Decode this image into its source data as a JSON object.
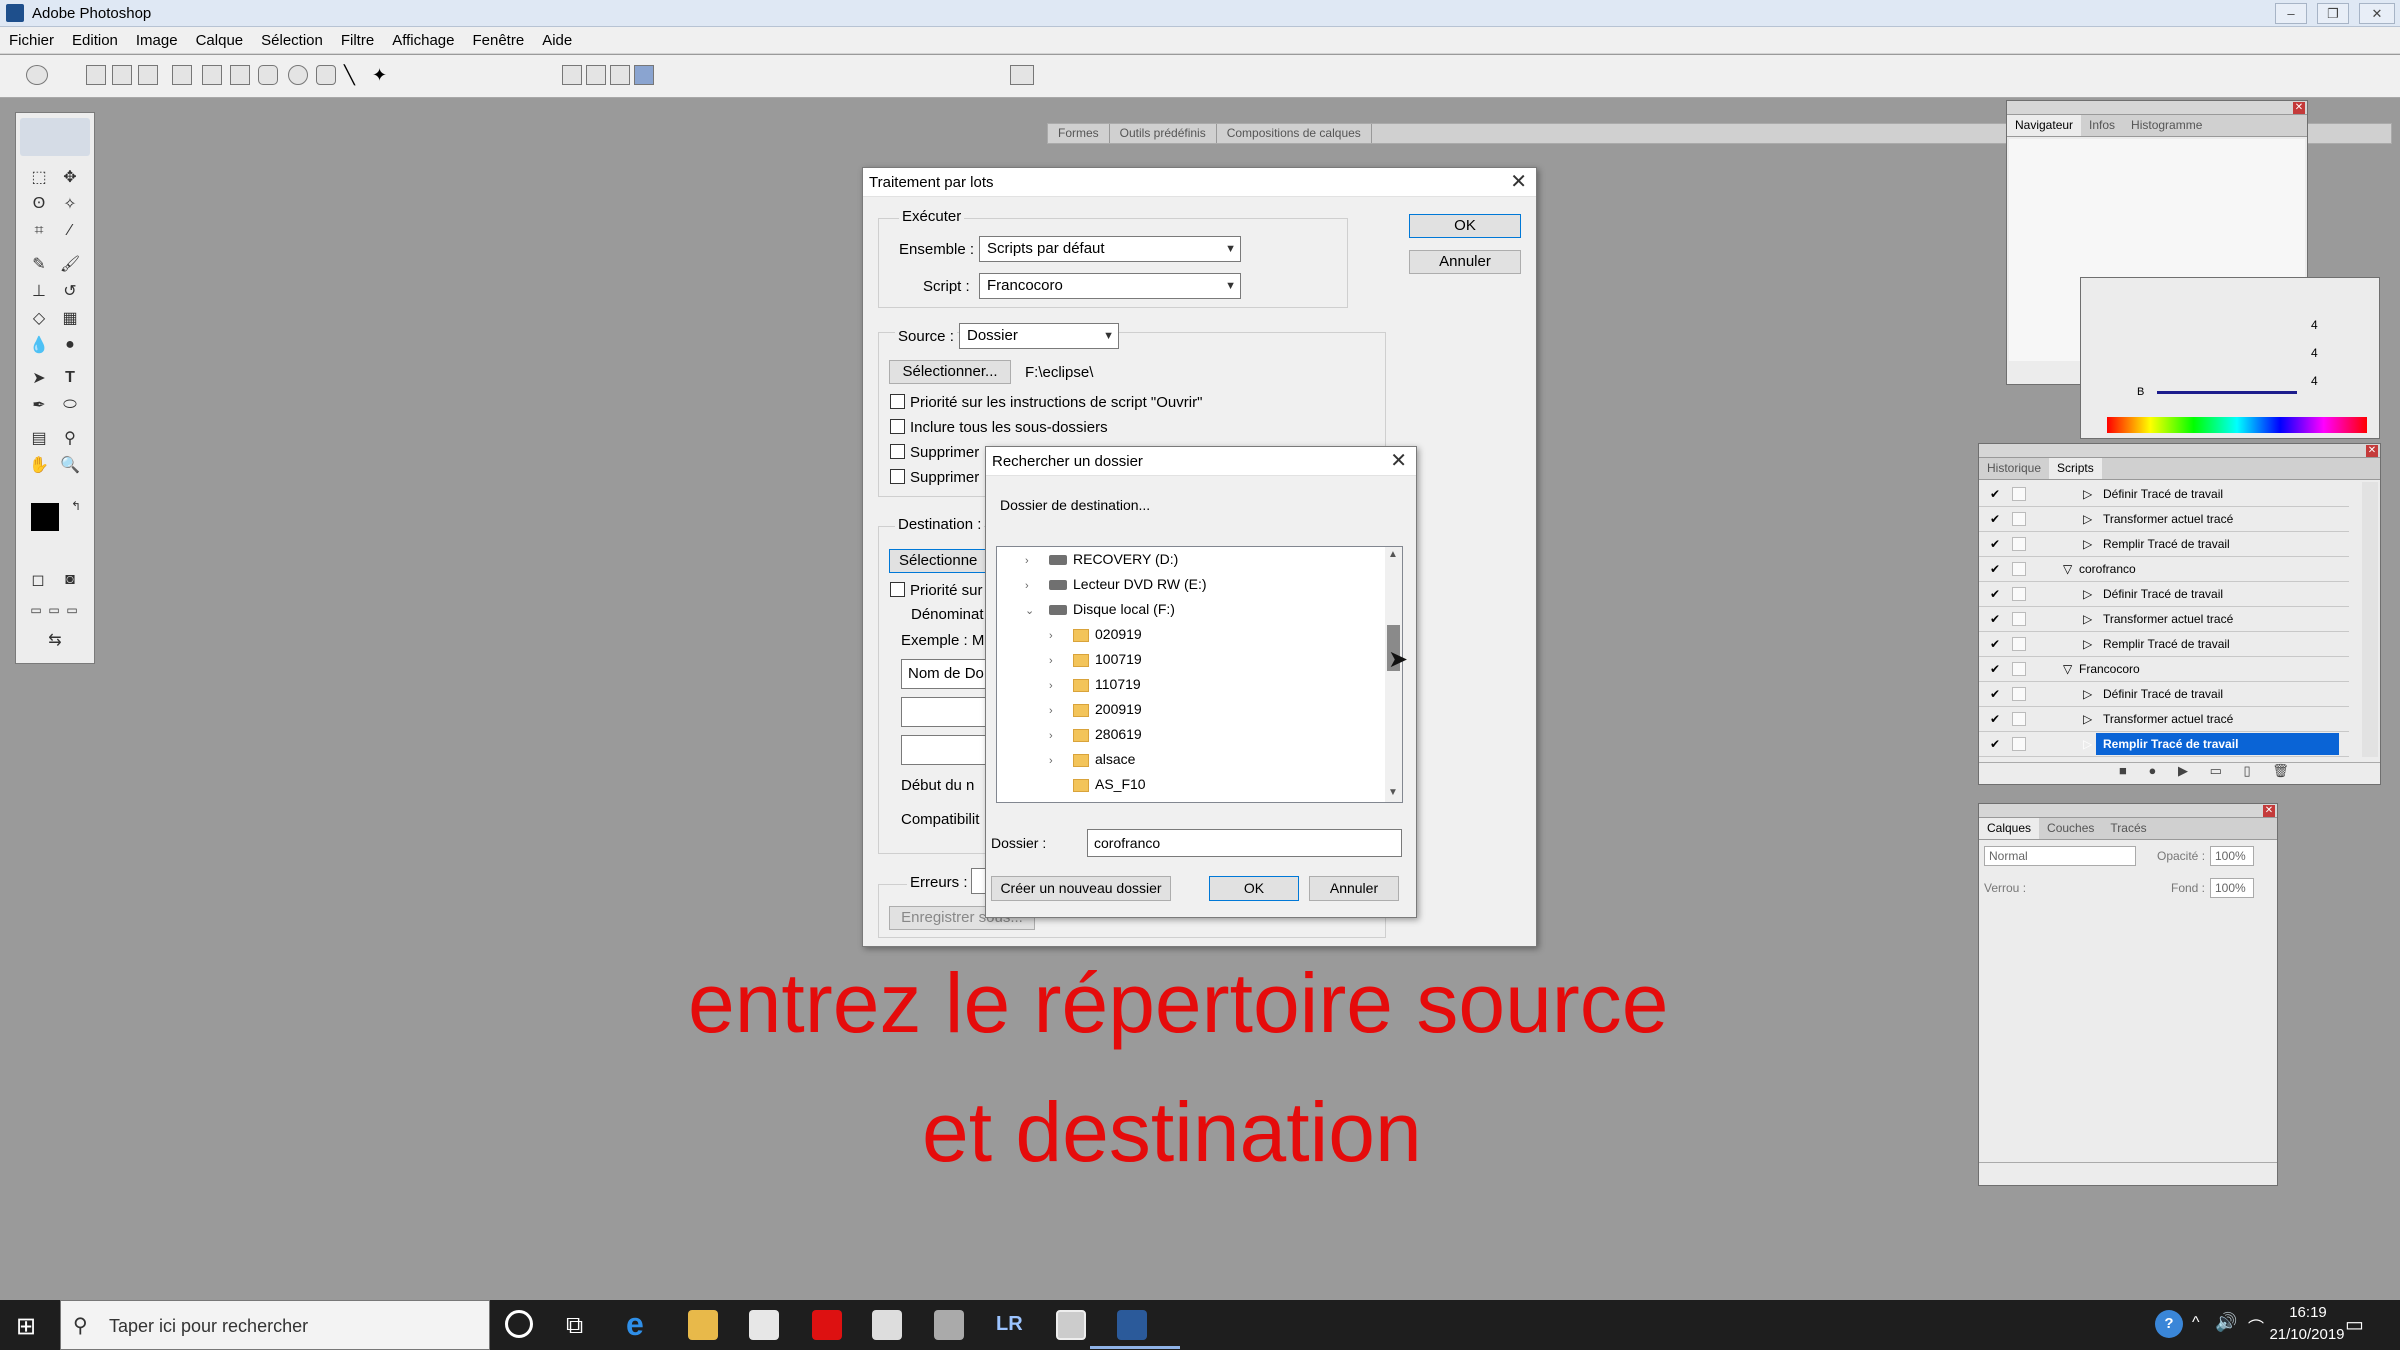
{
  "app": {
    "title": "Adobe Photoshop"
  },
  "menu": [
    "Fichier",
    "Edition",
    "Image",
    "Calque",
    "Sélection",
    "Filtre",
    "Affichage",
    "Fenêtre",
    "Aide"
  ],
  "palette_well": {
    "tabs": [
      "Formes",
      "Outils prédéfinis",
      "Compositions de calques"
    ]
  },
  "navigator": {
    "tabs": [
      "Navigateur",
      "Infos",
      "Histogramme"
    ]
  },
  "color_panel": {
    "values": [
      "4",
      "4",
      "4"
    ],
    "b_label": "B"
  },
  "scripts_panel": {
    "tabs": [
      "Historique",
      "Scripts"
    ],
    "rows": [
      {
        "label": "Définir Tracé de travail",
        "level": 2
      },
      {
        "label": "Transformer actuel tracé",
        "level": 2
      },
      {
        "label": "Remplir Tracé de travail",
        "level": 2
      },
      {
        "label": "corofranco",
        "level": 1
      },
      {
        "label": "Définir Tracé de travail",
        "level": 2
      },
      {
        "label": "Transformer actuel tracé",
        "level": 2
      },
      {
        "label": "Remplir Tracé de travail",
        "level": 2
      },
      {
        "label": "Francocoro",
        "level": 1
      },
      {
        "label": "Définir Tracé de travail",
        "level": 2
      },
      {
        "label": "Transformer actuel tracé",
        "level": 2
      },
      {
        "label": "Remplir Tracé de travail",
        "level": 2,
        "selected": true
      }
    ]
  },
  "layers_panel": {
    "tabs": [
      "Calques",
      "Couches",
      "Tracés"
    ],
    "mode": "Normal",
    "opacity_label": "Opacité :",
    "opacity": "100%",
    "lock_label": "Verrou :",
    "fill_label": "Fond :",
    "fill": "100%"
  },
  "batch_dialog": {
    "title": "Traitement par lots",
    "execute_label": "Exécuter",
    "set_label": "Ensemble :",
    "set_value": "Scripts par défaut",
    "script_label": "Script :",
    "script_value": "Francocoro",
    "source_label": "Source :",
    "source_value": "Dossier",
    "select_button": "Sélectionner...",
    "source_path": "F:\\eclipse\\",
    "checks": [
      "Priorité sur les instructions de script \"Ouvrir\"",
      "Inclure tous les sous-dossiers",
      "Supprimer",
      "Supprimer"
    ],
    "destination_label": "Destination :",
    "dest_select": "Sélectionne",
    "dest_check": "Priorité sur",
    "naming_label": "Dénominat",
    "example_label": "Exemple : M",
    "name_field": "Nom de Do",
    "serial_label": "Début du n",
    "compat_label": "Compatibilit",
    "errors_label": "Erreurs :",
    "save_as": "Enregistrer sous...",
    "ok": "OK",
    "cancel": "Annuler"
  },
  "folder_dialog": {
    "title": "Rechercher un dossier",
    "description": "Dossier de destination...",
    "tree": [
      {
        "label": "RECOVERY (D:)",
        "kind": "drive",
        "indent": 0,
        "chevron": "›"
      },
      {
        "label": "Lecteur DVD RW (E:)",
        "kind": "drive",
        "indent": 0,
        "chevron": "›"
      },
      {
        "label": "Disque local (F:)",
        "kind": "drive",
        "indent": 0,
        "chevron": "⌄"
      },
      {
        "label": "020919",
        "kind": "folder",
        "indent": 1,
        "chevron": "›"
      },
      {
        "label": "100719",
        "kind": "folder",
        "indent": 1,
        "chevron": "›"
      },
      {
        "label": "110719",
        "kind": "folder",
        "indent": 1,
        "chevron": "›"
      },
      {
        "label": "200919",
        "kind": "folder",
        "indent": 1,
        "chevron": "›"
      },
      {
        "label": "280619",
        "kind": "folder",
        "indent": 1,
        "chevron": "›"
      },
      {
        "label": "alsace",
        "kind": "folder",
        "indent": 1,
        "chevron": "›"
      },
      {
        "label": "AS_F10",
        "kind": "folder",
        "indent": 1,
        "chevron": ""
      }
    ],
    "folder_label": "Dossier :",
    "folder_value": "corofranco",
    "new_folder": "Créer un nouveau dossier",
    "ok": "OK",
    "cancel": "Annuler"
  },
  "overlay": {
    "line1": "entrez le répertoire source",
    "line2": "et destination",
    "color": "#e50b0b"
  },
  "taskbar": {
    "search_placeholder": "Taper ici pour rechercher",
    "time": "16:19",
    "date": "21/10/2019"
  }
}
